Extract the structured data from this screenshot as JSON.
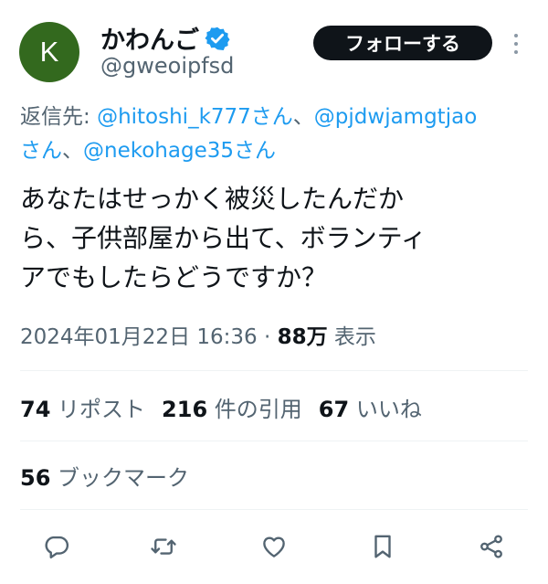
{
  "user": {
    "avatar_letter": "K",
    "display_name": "かわんご",
    "handle": "@gweoipfsd",
    "follow_label": "フォローする"
  },
  "reply": {
    "prefix": "返信先: ",
    "mention1": "@hitoshi_k777さん",
    "sep1": "、",
    "mention2": "@pjdwjamgtjao",
    "line2_mention2": "さん",
    "sep2": "、",
    "mention3": "@nekohage35さん"
  },
  "tweet": {
    "line1": "あなたはせっかく被災したんだか",
    "line2": "ら、子供部屋から出て、ボランティ",
    "line3": "アでもしたらどうですか？"
  },
  "meta": {
    "datetime": "2024年01月22日 16:36 · ",
    "views": "88万",
    "views_label": " 表示"
  },
  "stats": {
    "reposts_count": "74",
    "reposts_label": " リポスト",
    "quotes_count": "216",
    "quotes_label": " 件の引用",
    "likes_count": "67",
    "likes_label": " いいね",
    "bookmarks_count": "56",
    "bookmarks_label": " ブックマーク"
  },
  "actions": [
    "reply-icon",
    "repost-icon",
    "like-icon",
    "bookmark-icon",
    "share-icon"
  ],
  "colors": {
    "avatar_bg": "#33691e",
    "link": "#1d9bf0",
    "secondary_text": "#536471",
    "follow_bg": "#0f1419",
    "verified": "#1d9bf0"
  }
}
